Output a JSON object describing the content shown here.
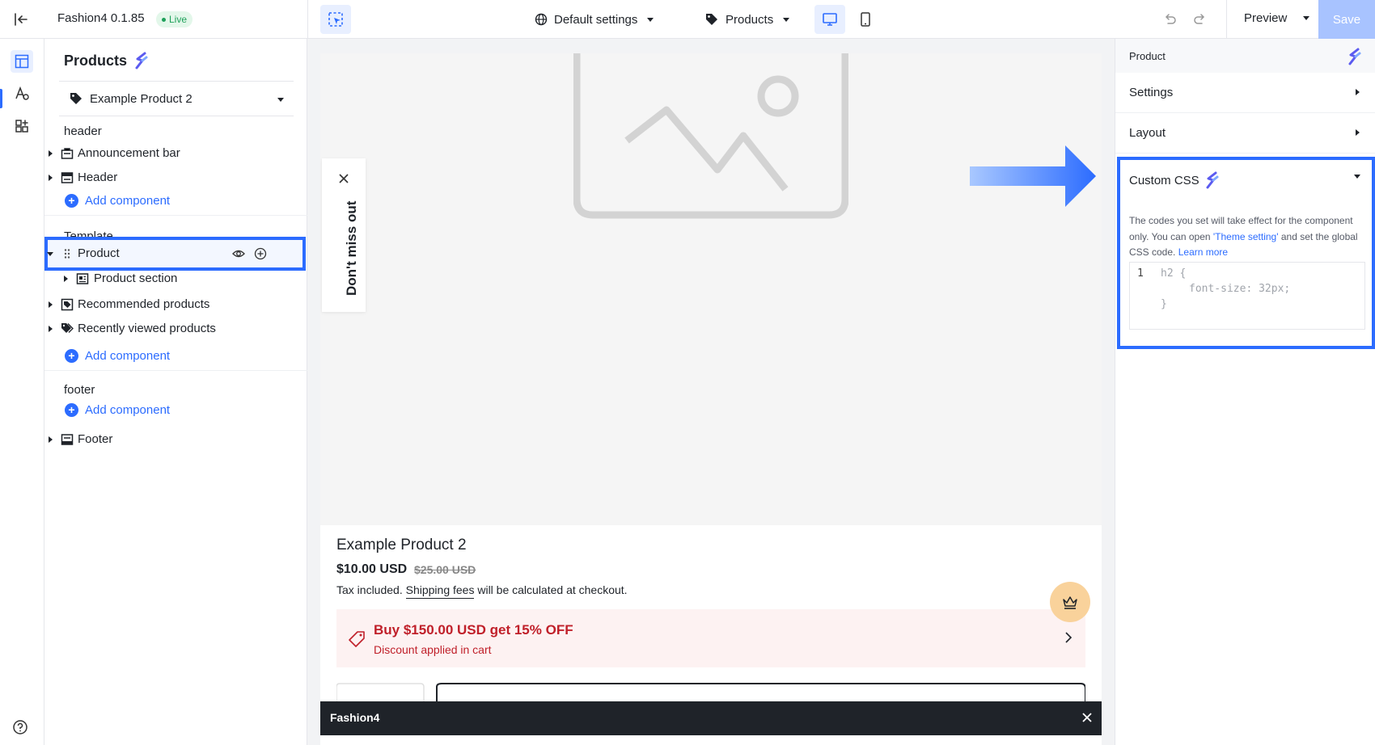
{
  "topbar": {
    "app_name": "Fashion4 0.1.85",
    "live_badge": "Live",
    "settings_dropdown": "Default settings",
    "page_dropdown": "Products",
    "preview_label": "Preview",
    "save_label": "Save"
  },
  "left_panel": {
    "title": "Products",
    "product_select": "Example Product 2",
    "groups": {
      "header": "header",
      "template": "Template",
      "footer": "footer"
    },
    "items": {
      "announcement_bar": "Announcement bar",
      "header": "Header",
      "product": "Product",
      "product_section": "Product section",
      "recommended_products": "Recommended products",
      "recently_viewed_products": "Recently viewed products",
      "footer": "Footer"
    },
    "add_component": "Add component"
  },
  "canvas": {
    "popup_text": "Don't miss out",
    "product_title": "Example Product 2",
    "price": "$10.00 USD",
    "price_old": "$25.00 USD",
    "tax_prefix": "Tax included.",
    "tax_link": "Shipping fees",
    "tax_suffix": "will be calculated at checkout.",
    "promo_title": "Buy $150.00 USD get 15% OFF",
    "promo_sub": "Discount applied in cart",
    "notification_title": "Fashion4"
  },
  "right_panel": {
    "header_title": "Product",
    "settings": "Settings",
    "layout": "Layout",
    "custom_css": "Custom CSS",
    "desc_1": "The codes you set will take effect for the component only. You can open",
    "desc_link_1": "'Theme setting'",
    "desc_2": "and set the global CSS code.",
    "desc_link_2": "Learn more",
    "code_line_number": "1",
    "code_line_1": "h2 {",
    "code_line_2": "font-size: 32px;",
    "code_line_3": "}"
  },
  "colors": {
    "accent": "#2c6cff",
    "live_green": "#1ea05a",
    "promo_red": "#c0202a",
    "save_disabled": "#a8c3ff"
  }
}
